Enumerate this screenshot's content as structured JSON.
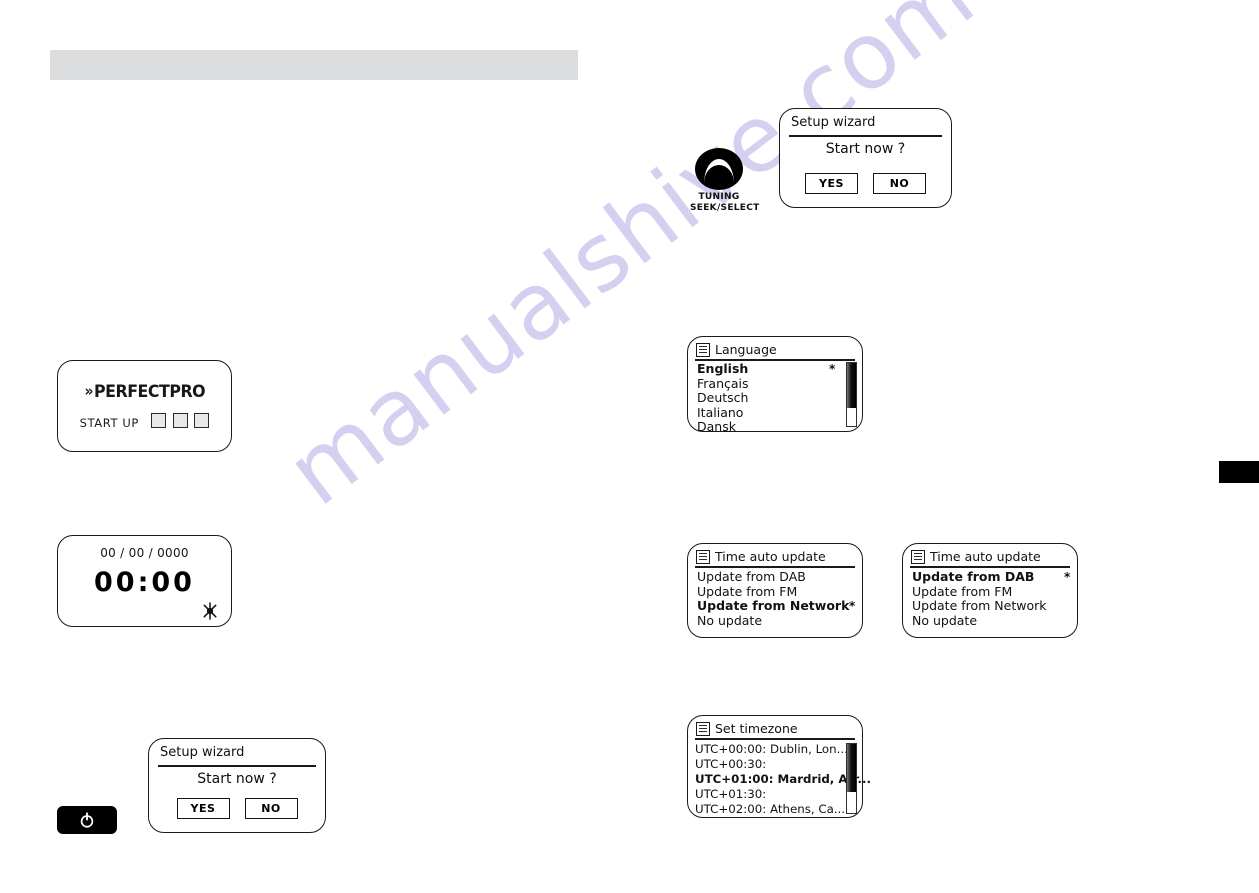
{
  "watermark": {
    "text": "manualshive.com",
    "color": "#d3d1ef"
  },
  "topbar": {
    "color": "#dcdddf"
  },
  "edge_tab": {
    "color": "#000000"
  },
  "startup_screen": {
    "brand_mark": "»",
    "brand": "PERFECTPRO",
    "startup_label": "START UP",
    "block_count": 3
  },
  "clock_screen": {
    "date": "00 / 00 / 0000",
    "time": "00:00",
    "icon": "sun-icon"
  },
  "setup_wizard": {
    "title": "Setup wizard",
    "question": "Start now ?",
    "yes_label": "YES",
    "no_label": "NO"
  },
  "power_button": {
    "icon": "power-icon"
  },
  "tuning_knob": {
    "icon": "rotary-knob-icon",
    "label_line1": "TUNING",
    "label_line2": "SEEK/SELECT"
  },
  "language_screen": {
    "icon": "menu-list-icon",
    "title": "Language",
    "items": [
      {
        "label": "English",
        "selected": true,
        "marker": "*"
      },
      {
        "label": "Français",
        "selected": false,
        "marker": ""
      },
      {
        "label": "Deutsch",
        "selected": false,
        "marker": ""
      },
      {
        "label": "Italiano",
        "selected": false,
        "marker": ""
      },
      {
        "label": "Dansk",
        "selected": false,
        "marker": ""
      }
    ],
    "scroll_percent": 72
  },
  "time_update_screen_1": {
    "icon": "menu-list-icon",
    "title": "Time auto update",
    "items": [
      {
        "label": "Update from DAB",
        "selected": false,
        "marker": ""
      },
      {
        "label": "Update from FM",
        "selected": false,
        "marker": ""
      },
      {
        "label": "Update from Network",
        "selected": true,
        "marker": "*"
      },
      {
        "label": "No update",
        "selected": false,
        "marker": ""
      }
    ]
  },
  "time_update_screen_2": {
    "icon": "menu-list-icon",
    "title": "Time auto update",
    "items": [
      {
        "label": "Update from DAB",
        "selected": true,
        "marker": "*"
      },
      {
        "label": "Update from FM",
        "selected": false,
        "marker": ""
      },
      {
        "label": "Update from Network",
        "selected": false,
        "marker": ""
      },
      {
        "label": "No update",
        "selected": false,
        "marker": ""
      }
    ]
  },
  "timezone_screen": {
    "icon": "menu-list-icon",
    "title": "Set timezone",
    "items": [
      {
        "label": "UTC+00:00: Dublin, Lon...",
        "selected": false,
        "marker": ""
      },
      {
        "label": "UTC+00:30:",
        "selected": false,
        "marker": ""
      },
      {
        "label": "UTC+01:00: Mardrid, Arr...",
        "selected": true,
        "marker": ""
      },
      {
        "label": "UTC+01:30:",
        "selected": false,
        "marker": ""
      },
      {
        "label": "UTC+02:00: Athens, Ca...",
        "selected": false,
        "marker": ""
      }
    ],
    "scroll_percent": 70
  }
}
